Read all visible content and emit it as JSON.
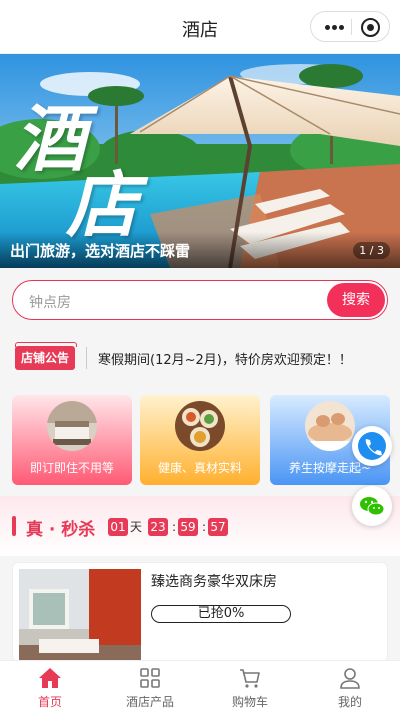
{
  "nav": {
    "title": "酒店"
  },
  "banner": {
    "big_word_1": "酒",
    "big_word_2": "店",
    "caption": "出门旅游，选对酒店不踩雷",
    "pager": "1 / 3"
  },
  "search": {
    "placeholder": "钟点房",
    "button": "搜索"
  },
  "notice": {
    "tag": "店铺公告",
    "text": "寒假期间(12月~2月)，特价房欢迎预定！！"
  },
  "features": [
    {
      "label": "即订即住不用等"
    },
    {
      "label": "健康、真材实料"
    },
    {
      "label": "养生按摩走起~"
    }
  ],
  "flash_sale": {
    "title": "真 · 秒杀",
    "countdown": {
      "days": "01",
      "day_unit": "天",
      "hours": "23",
      "minutes": "59",
      "seconds": "57",
      "sep": ":"
    }
  },
  "product": {
    "name": "臻选商务豪华双床房",
    "progress": "已抢0%"
  },
  "tabbar": [
    {
      "label": "首页",
      "icon": "home-icon",
      "active": true
    },
    {
      "label": "酒店产品",
      "icon": "grid-icon",
      "active": false
    },
    {
      "label": "购物车",
      "icon": "cart-icon",
      "active": false
    },
    {
      "label": "我的",
      "icon": "user-icon",
      "active": false
    }
  ],
  "colors": {
    "accent": "#e63a57",
    "search_button": "#f2305a"
  }
}
